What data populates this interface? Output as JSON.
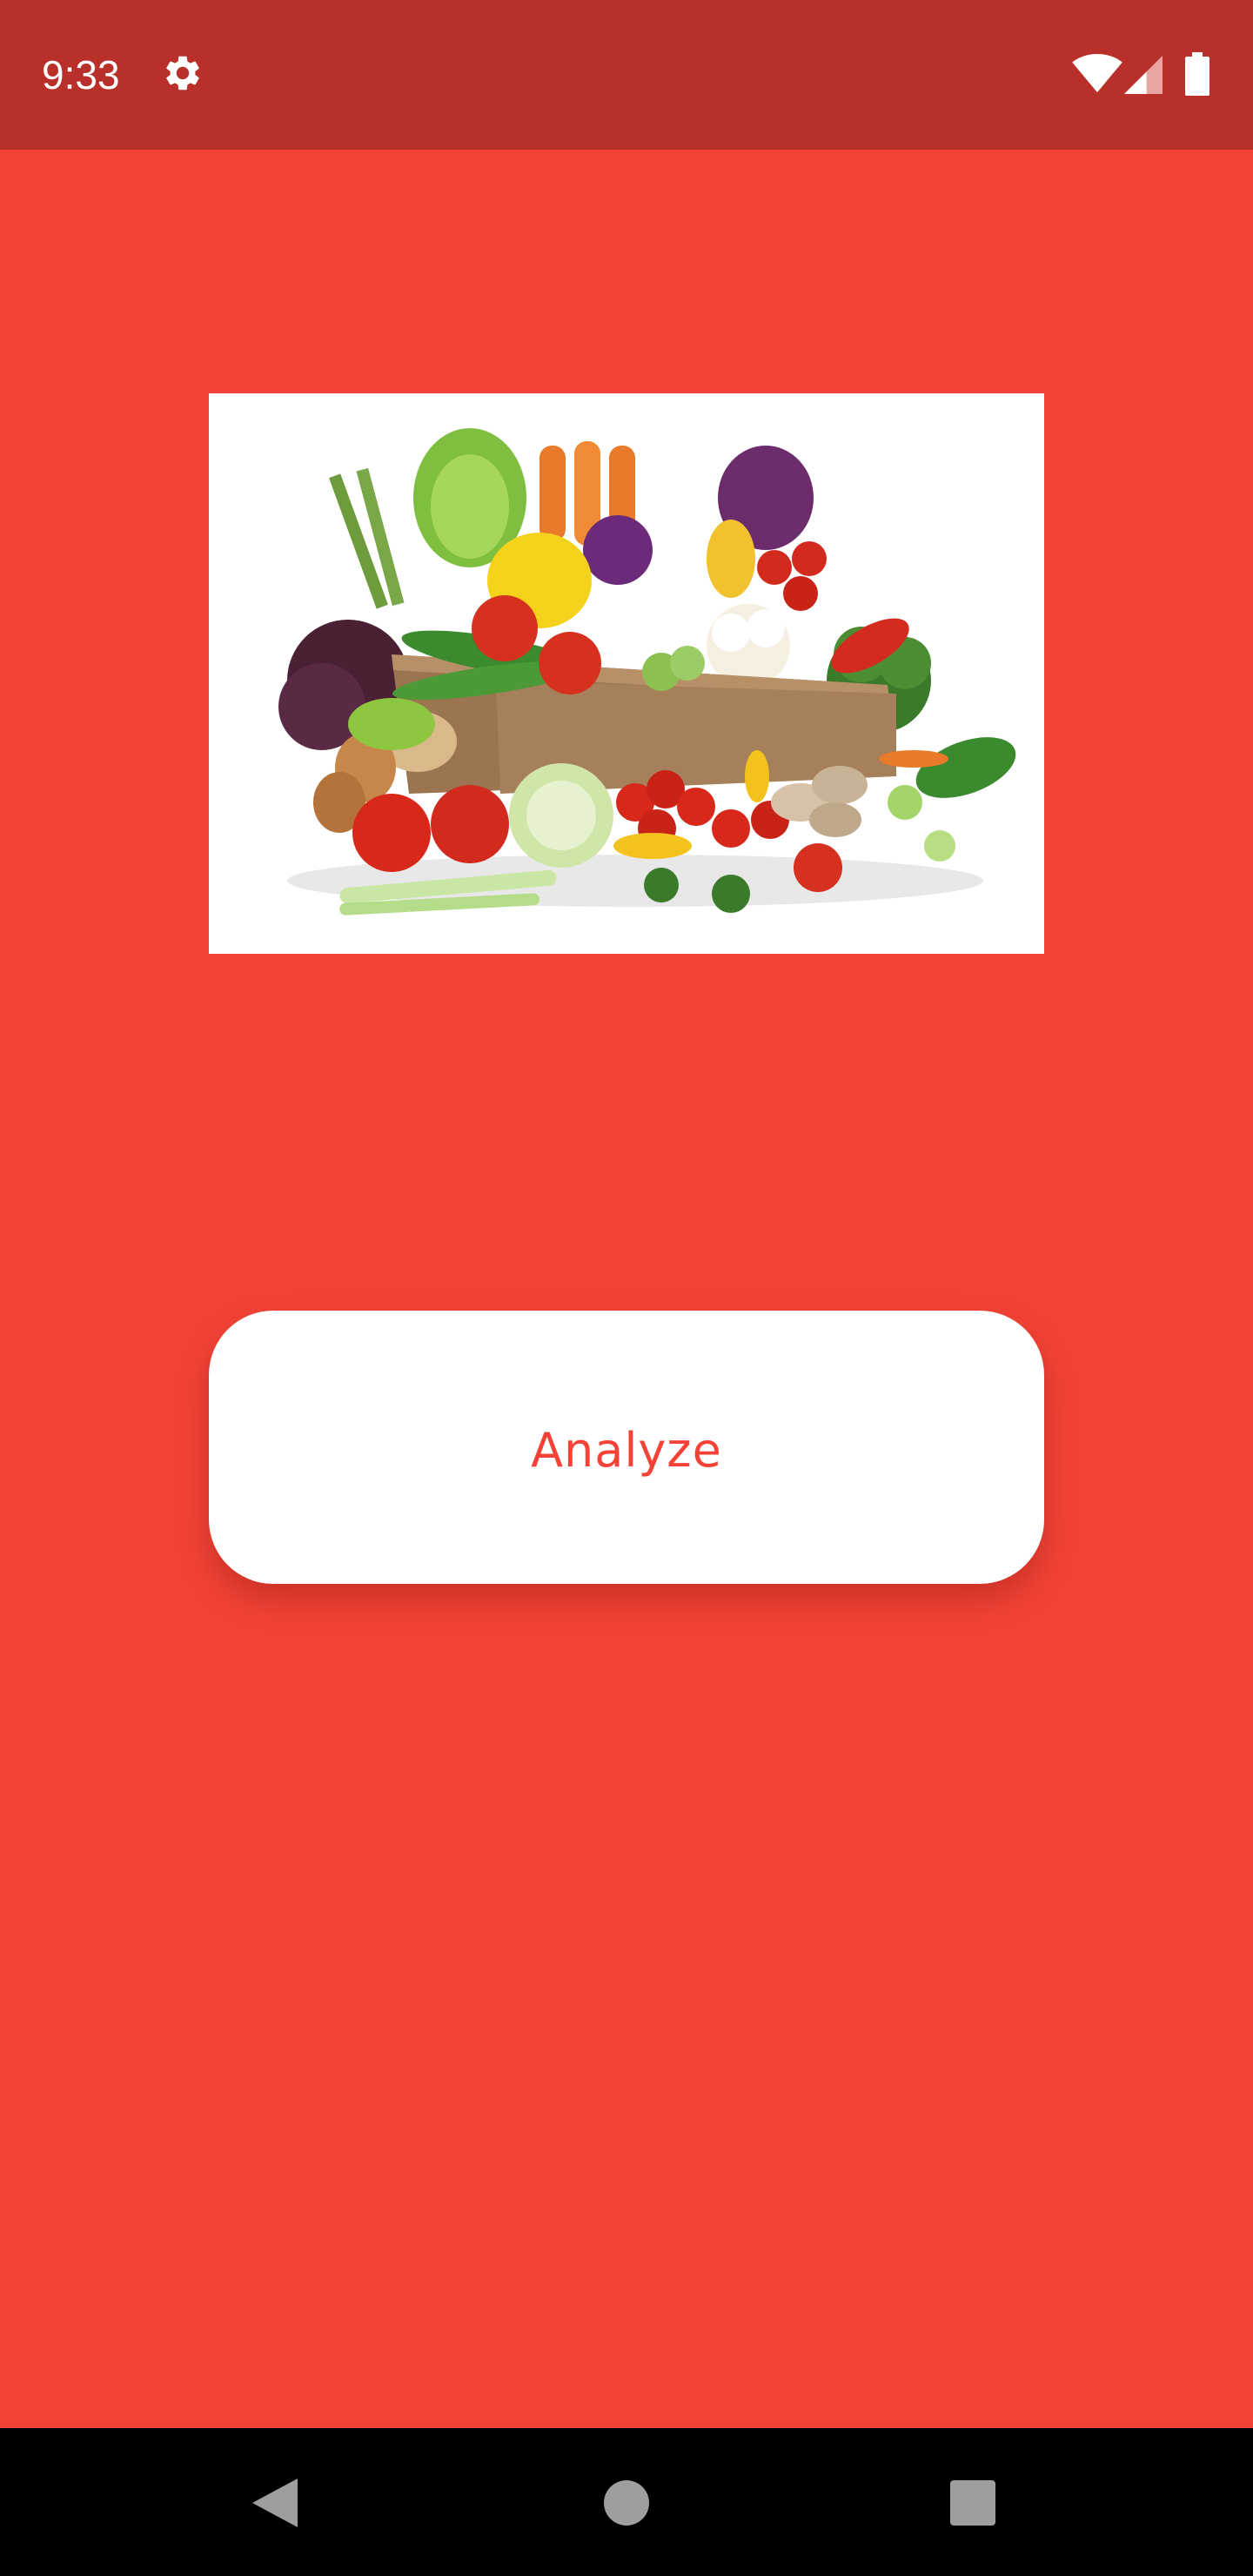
{
  "status_bar": {
    "time": "9:33",
    "icons": [
      "gear-icon",
      "wifi-icon",
      "cellular-signal-icon",
      "battery-icon"
    ],
    "background": "#b9302a"
  },
  "main": {
    "background": "#f44336",
    "image": {
      "alt": "vegetables-box-photo"
    },
    "analyze_button": {
      "label": "Analyze",
      "text_color": "#f44336",
      "background": "#ffffff"
    }
  },
  "nav_bar": {
    "icons": [
      "back-icon",
      "home-icon",
      "recents-icon"
    ],
    "background": "#000000"
  }
}
